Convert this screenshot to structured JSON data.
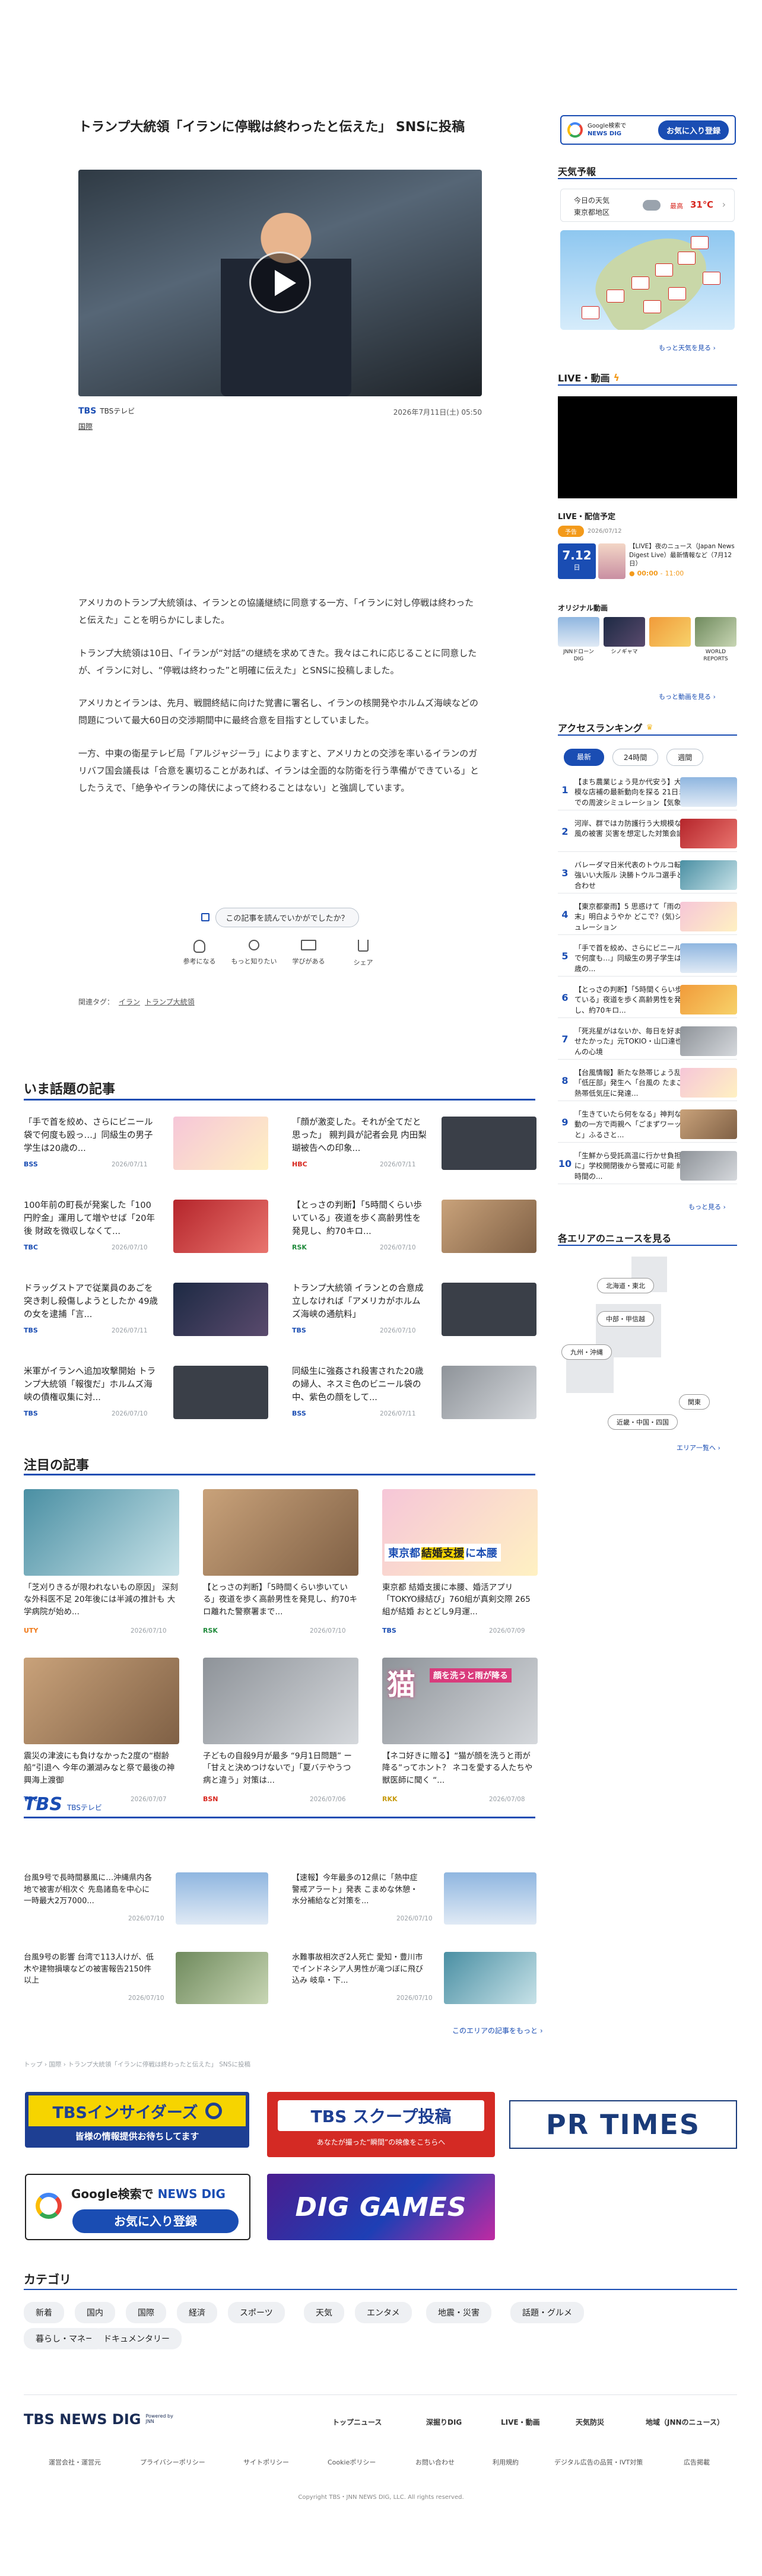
{
  "article": {
    "title": "トランプ大統領「イランに停戦は終わったと伝えた」 SNSに投稿",
    "source_logo": "TBS",
    "source_name": "TBSテレビ",
    "date": "2026年7月11日(土) 05:50",
    "category": "国際",
    "paragraphs": [
      "アメリカのトランプ大統領は、イランとの協議継続に同意する一方、「イランに対し停戦は終わったと伝えた」ことを明らかにしました。",
      "トランプ大統領は10日、「イランが“対話”の継続を求めてきた。我々はこれに応じることに同意したが、イランに対し、“停戦は終わった”と明確に伝えた」とSNSに投稿しました。",
      "アメリカとイランは、先月、戦闘終結に向けた覚書に署名し、イランの核開発やホルムズ海峡などの問題について最大60日の交渉期間中に最終合意を目指すとしていました。",
      "一方、中東の衛星テレビ局「アルジャジーラ」によりますと、アメリカとの交渉を率いるイランのガリバフ国会議長は「合意を裏切ることがあれば、イランは全面的な防衛を行う準備ができている」としたうえで、「絶争やイランの降伏によって終わることはない」と強調しています。"
    ],
    "feedback_question": "この記事を読んでいかがでしたか？",
    "reactions": [
      "参考になる",
      "もっと知りたい",
      "学びがある",
      "シェア"
    ],
    "tags_label": "関連タグ：",
    "tags": [
      "イラン",
      "トランプ大統領"
    ]
  },
  "sidebar": {
    "google_btn_small": "Google検索で",
    "google_btn_brand": "NEWS DIG",
    "google_btn_action": "お気に入り登録",
    "weather_title": "天気予報",
    "weather_today": "今日の天気",
    "weather_region": "東京都地区",
    "weather_label_high": "最高",
    "weather_temp": "31℃",
    "weather_more": "もっと天気を見る",
    "live_title": "LIVE・動画",
    "live_schedule": "LIVE・配信予定",
    "live_badge": "予告",
    "live_date_small": "2026/07/12",
    "live_date": "7.12",
    "live_day": "日",
    "live_item_title": "【LIVE】夜のニュース（Japan News Digest Live）最新情報など（7月12日）",
    "live_time_start": "00:00",
    "live_time_end": "11:00",
    "original_title": "オリジナル動画",
    "originals": [
      "JNNドローン DIG",
      "シノギャマ",
      "",
      "WORLD REPORTS"
    ],
    "videos_more": "もっと動画を見る",
    "ranking_title": "アクセスランキング",
    "ranking_tabs": [
      "最新",
      "24時間",
      "週間"
    ],
    "rankings": [
      "【まち農業じょう見か代安う】大規模な店補の最新動向を探る 21日までの周波シミュレーション【気象...",
      "河岸、群ではカ防護行う大規模な台風の被害 災害を想定した対策会議",
      "バレーダマ日米代表のトウルコ転先 強いい大阪ル 決勝トウルコ選手と顔合わせ",
      "【東京都豪雨】5 思惑けて「雨の週末」明白ようやか どこで？(気)シミュレーション",
      "「手で首を絞め、さらにビニール袋で何度も…」同級生の男子学生は20歳の...",
      "【とっさの判断】「5時間くらい歩いている」夜道を歩く高齢男性を発見し、約70キロ...",
      "「死兆星がはないか、毎日を好まわせたかった」元TOKIO・山口達也さんの心境",
      "【台風情報】新たな熱帯じょう乱「低圧部」発生へ「台風の たまご」熱帯低気圧に発達...",
      "「生きていたら何をなる」神判な不動の一方で両親へ「ごまずワーッと」ふるさと...",
      "「生鮮から受託高温に行かせ負担に」学校開閉後から警戒に可能 約1時間の..."
    ],
    "ranking_more": "もっと見る",
    "area_title": "各エリアのニュースを見る",
    "areas": [
      "北海道・東北",
      "中部・甲信越",
      "九州・沖縄",
      "関東",
      "近畿・中国・四国"
    ],
    "area_more": "エリア一覧へ"
  },
  "trending": {
    "title": "いま話題の記事",
    "items": [
      {
        "title": "「手で首を絞め、さらにビニール袋で何度も殴っ…」同級生の男子学生は20歳の...",
        "src": "BSS",
        "date": "2026/07/11"
      },
      {
        "title": "「顔が激変した。それが全てだと思った」 親判員が記者会見 内田梨瑚被告への印象...",
        "src": "HBC",
        "date": "2026/07/11"
      },
      {
        "title": "100年前の町長が発案した「100円貯金」運用して増やせば「20年後 財政を微収しなくて...",
        "src": "TBC",
        "date": "2026/07/10"
      },
      {
        "title": "【とっさの判断】「5時間くらい歩いている」夜道を歩く高齢男性を発見し、約70キロ...",
        "src": "RSK",
        "date": "2026/07/10"
      },
      {
        "title": "ドラッグストアで従業員のあごを突き刺し殺傷しようとしたか 49歳の女を逮捕「言...",
        "src": "TBS",
        "date": "2026/07/11"
      },
      {
        "title": "トランプ大統領 イランとの合意成立しなければ「アメリカがホルムズ海峡の通航料」",
        "src": "TBS",
        "date": "2026/07/10"
      },
      {
        "title": "米軍がイランへ追加攻撃開始 トランプ大統領「報復だ」ホルムズ海峡の債権収集に対...",
        "src": "TBS",
        "date": "2026/07/10"
      },
      {
        "title": "同級生に強姦され殺害された20歳の婦人、ネスミ色のビニール袋の中、紫色の顔をして...",
        "src": "BSS",
        "date": "2026/07/11"
      }
    ]
  },
  "featured": {
    "title": "注目の記事",
    "items": [
      {
        "title": "「芝刈りきるが限われないもの原因」 深刻な外科医不足 20年後には半減の推計も 大学病院が始め...",
        "src": "UTY",
        "date": "2026/07/10"
      },
      {
        "title": "【とっさの判断】「5時間くらい歩いている」夜道を歩く高齢男性を発見し、約70キロ離れた警察署まで...",
        "src": "RSK",
        "date": "2026/07/10"
      },
      {
        "title": "東京都 結婚支援に本腰、婚活アプリ「TOKYO縁結び」760組が真剣交際 265組が結婚 おとどし9月運...",
        "src": "TBS",
        "date": "2026/07/09"
      },
      {
        "title": "震災の津波にも負けなかった2度の“樹齢船”引退へ 今年の瀬湖みなと祭で最後の神興海上渡御",
        "src": "TBC",
        "date": "2026/07/07"
      },
      {
        "title": "子どもの自殺9月が最多 “9月1日問題” ー「甘えと決めつけないで」「夏バテやうつ病と違う」対策は...",
        "src": "BSN",
        "date": "2026/07/06"
      },
      {
        "title": "【ネコ好きに贈る】“猫が顔を洗うと雨が降る”ってホント？ ネコを愛する人たちや獣医師に聞く “...",
        "src": "RKK",
        "date": "2026/07/08"
      }
    ],
    "banner_text_1": "東京都",
    "banner_text_2": "結婚支援",
    "banner_text_3": "に本腰",
    "cat_text": "猫",
    "cat_caption": "顔を洗うと雨が降る"
  },
  "tbs_section": {
    "logo": "TBS",
    "label": "TBSテレビ",
    "items": [
      {
        "title": "台風9号で長時間暴風に…沖縄県内各地で被害が相次ぐ 先島諸島を中心に一時最大2万7000...",
        "date": "2026/07/10"
      },
      {
        "title": "【速報】今年最多の12県に「熱中症警戒アラート」発表 こまめな休憩・水分補給など対策を...",
        "date": "2026/07/10"
      },
      {
        "title": "台風9号の影響 台湾で113人けが、低木や建物損壊などの被害報告2150件以上",
        "date": "2026/07/10"
      },
      {
        "title": "水難事故相次ぎ2人死亡 愛知・豊川市でインドネシア人男性が滝つぼに飛び込み 岐阜・下...",
        "date": "2026/07/10"
      }
    ],
    "more": "このエリアの記事をもっと"
  },
  "breadcrumb": "トップ › 国際 › トランプ大統領「イランに停戦は終わったと伝えた」 SNSに投稿",
  "banners": {
    "insider_title": "TBSインサイダーズ",
    "insider_sub": "皆様の情報提供お待ちしてます",
    "scoop_title": "TBS スクープ投稿",
    "scoop_sub": "あなたが撮った“瞬間”の映像をこちらへ",
    "prtimes": "PR TIMES",
    "google_small": "Google検索で",
    "google_brand": "NEWS DIG",
    "google_action": "お気に入り登録",
    "dig_games": "DIG GAMES"
  },
  "categories": {
    "title": "カテゴリ",
    "items": [
      "新着",
      "国内",
      "国際",
      "経済",
      "スポーツ",
      "天気",
      "エンタメ",
      "地震・災害",
      "話題・グルメ",
      "暮らし・マネー",
      "ドキュメンタリー"
    ]
  },
  "footer": {
    "logo": "TBS NEWS DIG",
    "logo_sub": "Powered by JNN",
    "nav": [
      "トップニュース",
      "深掘りDIG",
      "LIVE・動画",
      "天気防災",
      "地域（JNNのニュース）"
    ],
    "links": [
      "運営会社・運営元",
      "プライバシーポリシー",
      "サイトポリシー",
      "Cookieポリシー",
      "お問い合わせ",
      "利用規約",
      "デジタル広告の品質・IVT対策",
      "広告掲載"
    ],
    "copyright": "Copyright TBS・JNN NEWS DIG, LLC. All rights reserved."
  },
  "colors": {
    "accent": "#1a4db3",
    "badge_orange": "#f39a1b",
    "tbs_blue": "#1a4db3"
  }
}
